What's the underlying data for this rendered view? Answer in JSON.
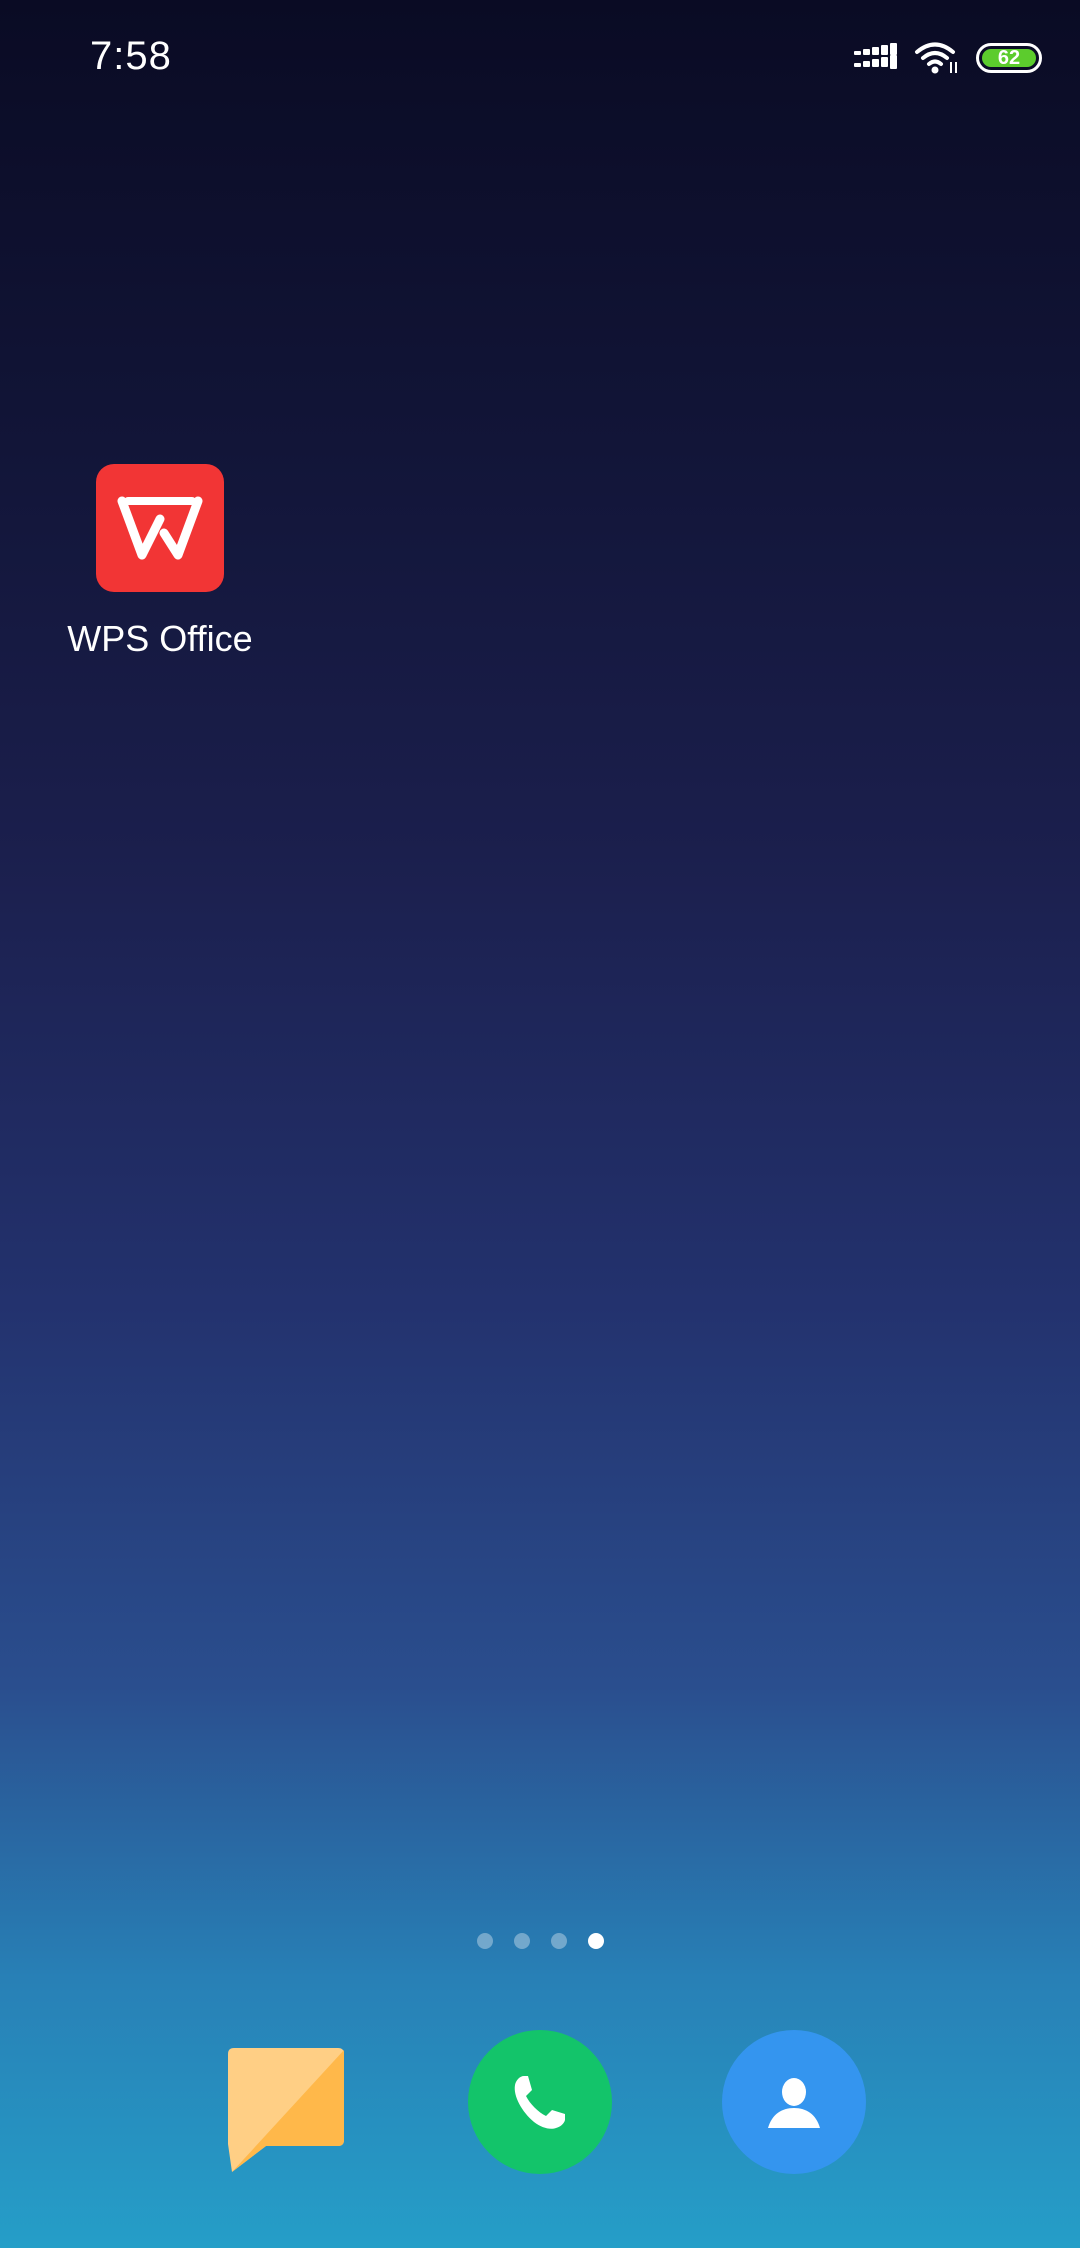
{
  "status_bar": {
    "time": "7:58",
    "battery_level": "62",
    "icons": [
      "signal-icon",
      "wifi-icon",
      "battery-icon"
    ]
  },
  "home": {
    "apps": [
      {
        "label": "WPS Office",
        "icon": "wps-office-icon",
        "color": "#f23535"
      }
    ]
  },
  "page_indicator": {
    "total": 4,
    "active": 4
  },
  "dock": {
    "apps": [
      {
        "icon": "messages-icon",
        "color": "#ffbb4d"
      },
      {
        "icon": "phone-icon",
        "color": "#13c46a"
      },
      {
        "icon": "contacts-icon",
        "color": "#3495ef"
      }
    ]
  },
  "colors": {
    "battery_fill": "#5ccc2d"
  }
}
